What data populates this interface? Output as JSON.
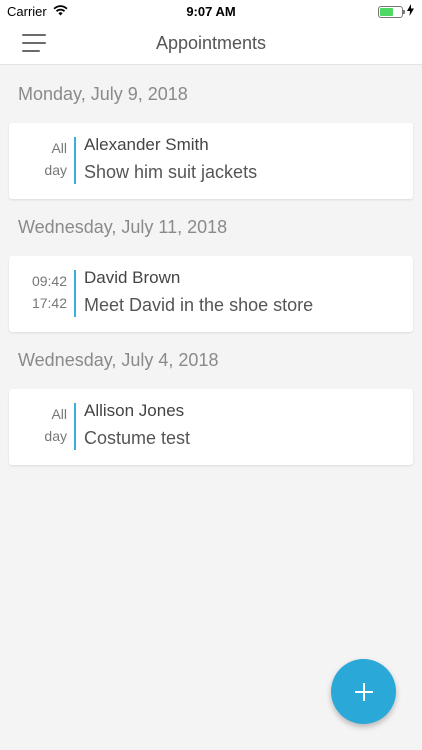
{
  "status_bar": {
    "carrier": "Carrier",
    "time": "9:07 AM",
    "battery_level": 0.6
  },
  "nav": {
    "title": "Appointments",
    "menu_icon": "hamburger-menu-icon"
  },
  "sections": [
    {
      "date": "Monday, July 9, 2018",
      "appointments": [
        {
          "time_line1": "All",
          "time_line2": "day",
          "name": "Alexander Smith",
          "description": "Show him suit jackets"
        }
      ]
    },
    {
      "date": "Wednesday, July 11, 2018",
      "appointments": [
        {
          "time_line1": "09:42",
          "time_line2": "17:42",
          "name": "David Brown",
          "description": "Meet David in the shoe store"
        }
      ]
    },
    {
      "date": "Wednesday, July 4, 2018",
      "appointments": [
        {
          "time_line1": "All",
          "time_line2": "day",
          "name": "Allison Jones",
          "description": "Costume test"
        }
      ]
    }
  ],
  "fab": {
    "icon": "plus-icon"
  },
  "colors": {
    "accent": "#2aa8d8",
    "divider": "#3aaed8",
    "background": "#f4f4f4",
    "battery": "#4cd964"
  }
}
